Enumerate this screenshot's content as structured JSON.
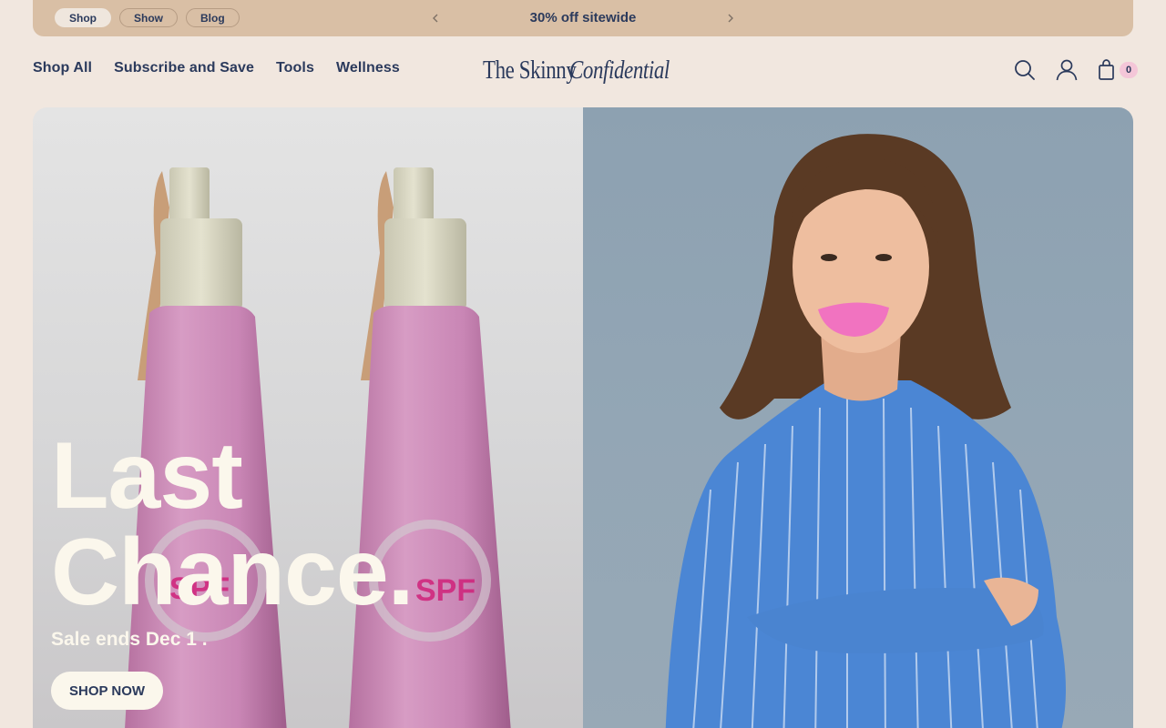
{
  "announcement": {
    "tabs": [
      {
        "label": "Shop",
        "active": true
      },
      {
        "label": "Show",
        "active": false
      },
      {
        "label": "Blog",
        "active": false
      }
    ],
    "promo_text": "30% off sitewide",
    "prev_icon": "chevron-left-icon",
    "next_icon": "chevron-right-icon"
  },
  "header": {
    "nav": [
      "Shop All",
      "Subscribe and Save",
      "Tools",
      "Wellness"
    ],
    "logo": {
      "part1": "The Skinny",
      "part2": "Confidential"
    },
    "icons": [
      "search-icon",
      "account-icon",
      "cart-icon"
    ],
    "cart_count": "0"
  },
  "hero": {
    "title_line1": "Last",
    "title_line2": "Chance.",
    "subtitle": "Sale ends Dec 1 .",
    "cta_label": "SHOP NOW",
    "left_image": "pink-sunscreen-bottles",
    "right_image": "model-blue-striped-shirt-pink-lip-mask"
  },
  "colors": {
    "background": "#f1e7df",
    "announcement_bg": "#d9bfa5",
    "text": "#2b3a5c",
    "cart_badge": "#f4c6d8",
    "hero_text": "#fbf7ec"
  }
}
